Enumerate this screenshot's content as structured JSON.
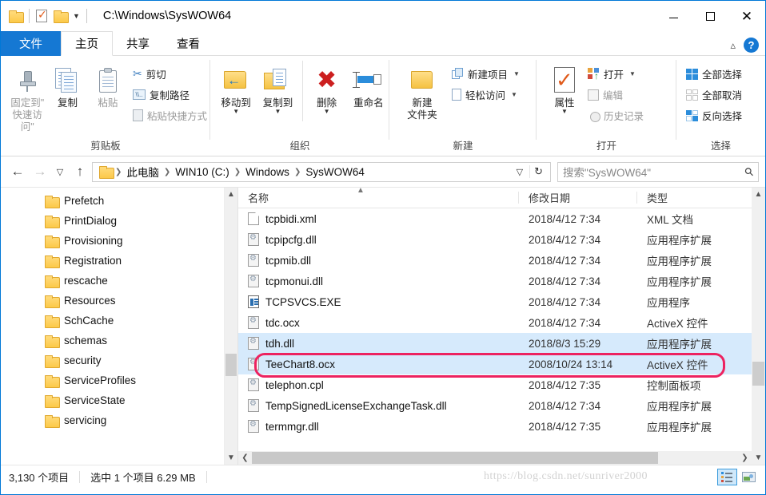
{
  "window": {
    "title": "C:\\Windows\\SysWOW64",
    "quick_access": [
      "folder-icon",
      "properties-icon",
      "folder-icon"
    ],
    "buttons": {
      "minimize": "minimize-icon",
      "maximize": "maximize-icon",
      "close": "close-icon"
    }
  },
  "ribbon": {
    "tabs": [
      {
        "label": "文件",
        "kind": "file"
      },
      {
        "label": "主页",
        "kind": "active"
      },
      {
        "label": "共享",
        "kind": "normal"
      },
      {
        "label": "查看",
        "kind": "normal"
      }
    ],
    "collapse_icon": "chevron-up-icon",
    "help_label": "?",
    "groups": [
      {
        "name": "剪贴板",
        "big": [
          {
            "label": "固定到\"\n快速访问\"",
            "line1": "固定到\"",
            "line2": "快速访问\"",
            "icon": "pin-icon",
            "disabled": true
          },
          {
            "label": "复制",
            "line1": "复制",
            "line2": "",
            "icon": "copy-icon",
            "disabled": false
          },
          {
            "label": "粘贴",
            "line1": "粘贴",
            "line2": "",
            "icon": "paste-icon",
            "disabled": true
          }
        ],
        "small": [
          {
            "label": "剪切",
            "icon": "scissors-icon",
            "disabled": false
          },
          {
            "label": "复制路径",
            "icon": "copy-path-icon",
            "disabled": false
          },
          {
            "label": "粘贴快捷方式",
            "icon": "paste-shortcut-icon",
            "disabled": true
          }
        ]
      },
      {
        "name": "组织",
        "big": [
          {
            "line1": "移动到",
            "line2": "",
            "icon": "move-to-icon",
            "caret": true,
            "disabled": false
          },
          {
            "line1": "复制到",
            "line2": "",
            "icon": "copy-to-icon",
            "caret": true,
            "disabled": false
          },
          {
            "line1": "删除",
            "line2": "",
            "icon": "delete-icon",
            "caret": true,
            "disabled": false
          },
          {
            "line1": "重命名",
            "line2": "",
            "icon": "rename-icon",
            "caret": false,
            "disabled": false
          }
        ],
        "small": []
      },
      {
        "name": "新建",
        "big": [
          {
            "line1": "新建",
            "line2": "文件夹",
            "icon": "new-folder-icon",
            "caret": false,
            "disabled": false
          }
        ],
        "small": [
          {
            "label": "新建项目",
            "icon": "new-item-icon",
            "caret": true,
            "disabled": false
          },
          {
            "label": "轻松访问",
            "icon": "easy-access-icon",
            "caret": true,
            "disabled": false
          }
        ]
      },
      {
        "name": "打开",
        "big": [
          {
            "line1": "属性",
            "line2": "",
            "icon": "properties-icon",
            "caret": true,
            "disabled": false
          }
        ],
        "small": [
          {
            "label": "打开",
            "icon": "open-icon",
            "caret": true,
            "disabled": false
          },
          {
            "label": "编辑",
            "icon": "edit-icon",
            "caret": false,
            "disabled": true
          },
          {
            "label": "历史记录",
            "icon": "history-icon",
            "caret": false,
            "disabled": true
          }
        ]
      },
      {
        "name": "选择",
        "big": [],
        "small": [
          {
            "label": "全部选择",
            "icon": "select-all-icon",
            "caret": false,
            "disabled": false
          },
          {
            "label": "全部取消",
            "icon": "select-none-icon",
            "caret": false,
            "disabled": false
          },
          {
            "label": "反向选择",
            "icon": "invert-selection-icon",
            "caret": false,
            "disabled": false
          }
        ]
      }
    ]
  },
  "addressbar": {
    "back_icon": "back-arrow-icon",
    "forward_icon": "forward-arrow-icon",
    "recent_icon": "chevron-down-icon",
    "up_icon": "up-arrow-icon",
    "breadcrumbs": [
      "此电脑",
      "WIN10 (C:)",
      "Windows",
      "SysWOW64"
    ],
    "dropdown_icon": "chevron-down-icon",
    "refresh_icon": "refresh-icon",
    "search_placeholder": "搜索\"SysWOW64\"",
    "search_value": "",
    "search_icon": "search-icon"
  },
  "navigation": {
    "items": [
      {
        "label": "Prefetch"
      },
      {
        "label": "PrintDialog"
      },
      {
        "label": "Provisioning"
      },
      {
        "label": "Registration"
      },
      {
        "label": "rescache"
      },
      {
        "label": "Resources"
      },
      {
        "label": "SchCache"
      },
      {
        "label": "schemas"
      },
      {
        "label": "security"
      },
      {
        "label": "ServiceProfiles"
      },
      {
        "label": "ServiceState"
      },
      {
        "label": "servicing"
      }
    ]
  },
  "filelist": {
    "columns": [
      {
        "key": "name",
        "label": "名称",
        "sorted": true,
        "sort_icon": "sort-ascending-icon"
      },
      {
        "key": "date",
        "label": "修改日期",
        "sorted": false
      },
      {
        "key": "type",
        "label": "类型",
        "sorted": false
      }
    ],
    "rows": [
      {
        "name": "tcpbidi.xml",
        "date": "2018/4/12 7:34",
        "type": "XML 文档",
        "icon": "xml-file-icon",
        "selected": false,
        "annotated": false
      },
      {
        "name": "tcpipcfg.dll",
        "date": "2018/4/12 7:34",
        "type": "应用程序扩展",
        "icon": "dll-file-icon",
        "selected": false,
        "annotated": false
      },
      {
        "name": "tcpmib.dll",
        "date": "2018/4/12 7:34",
        "type": "应用程序扩展",
        "icon": "dll-file-icon",
        "selected": false,
        "annotated": false
      },
      {
        "name": "tcpmonui.dll",
        "date": "2018/4/12 7:34",
        "type": "应用程序扩展",
        "icon": "dll-file-icon",
        "selected": false,
        "annotated": false
      },
      {
        "name": "TCPSVCS.EXE",
        "date": "2018/4/12 7:34",
        "type": "应用程序",
        "icon": "exe-file-icon",
        "selected": false,
        "annotated": false
      },
      {
        "name": "tdc.ocx",
        "date": "2018/4/12 7:34",
        "type": "ActiveX 控件",
        "icon": "ocx-file-icon",
        "selected": false,
        "annotated": false
      },
      {
        "name": "tdh.dll",
        "date": "2018/8/3 15:29",
        "type": "应用程序扩展",
        "icon": "dll-file-icon",
        "selected": true,
        "annotated": false
      },
      {
        "name": "TeeChart8.ocx",
        "date": "2008/10/24 13:14",
        "type": "ActiveX 控件",
        "icon": "ocx-file-icon",
        "selected": true,
        "annotated": true
      },
      {
        "name": "telephon.cpl",
        "date": "2018/4/12 7:35",
        "type": "控制面板项",
        "icon": "cpl-file-icon",
        "selected": false,
        "annotated": false
      },
      {
        "name": "TempSignedLicenseExchangeTask.dll",
        "date": "2018/4/12 7:34",
        "type": "应用程序扩展",
        "icon": "dll-file-icon",
        "selected": false,
        "annotated": false
      },
      {
        "name": "termmgr.dll",
        "date": "2018/4/12 7:35",
        "type": "应用程序扩展",
        "icon": "dll-file-icon",
        "selected": false,
        "annotated": false
      }
    ],
    "annotation_color": "#ed2360"
  },
  "statusbar": {
    "item_count": "3,130 个项目",
    "selection": "选中 1 个项目  6.29 MB",
    "watermark": "https://blog.csdn.net/sunriver2000",
    "views": [
      {
        "name": "details-view",
        "icon": "details-view-icon",
        "active": true
      },
      {
        "name": "large-icons-view",
        "icon": "large-icons-view-icon",
        "active": false
      }
    ]
  }
}
